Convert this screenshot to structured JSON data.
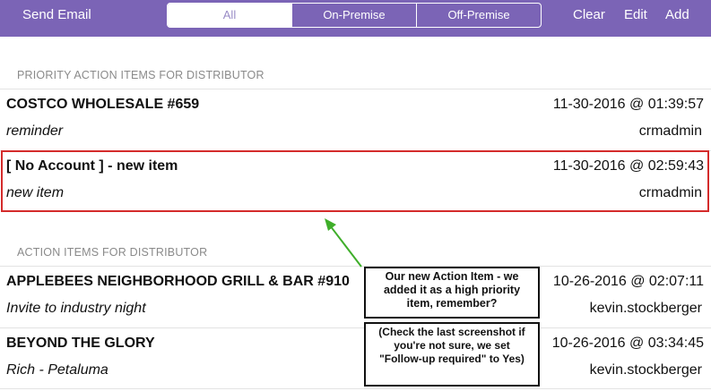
{
  "toolbar": {
    "send_email": "Send Email",
    "segments": [
      "All",
      "On-Premise",
      "Off-Premise"
    ],
    "selected_segment": "All",
    "clear": "Clear",
    "edit": "Edit",
    "add": "Add"
  },
  "priority_section": {
    "header": "PRIORITY ACTION ITEMS FOR DISTRIBUTOR",
    "items": [
      {
        "title": "COSTCO WHOLESALE #659",
        "date": "11-30-2016 @ 01:39:57",
        "note": "reminder",
        "user": "crmadmin"
      },
      {
        "title": "[ No Account ] - new item",
        "date": "11-30-2016 @ 02:59:43",
        "note": "new item",
        "user": "crmadmin"
      }
    ]
  },
  "action_section": {
    "header": "ACTION ITEMS FOR DISTRIBUTOR",
    "items": [
      {
        "title": "APPLEBEES NEIGHBORHOOD GRILL & BAR #910",
        "date": "10-26-2016 @ 02:07:11",
        "note": "Invite to industry night",
        "user": "kevin.stockberger"
      },
      {
        "title": "BEYOND THE GLORY",
        "date": "10-26-2016 @ 03:34:45",
        "note": "Rich - Petaluma",
        "user": "kevin.stockberger"
      }
    ]
  },
  "annotations": {
    "callout_1": "Our new Action Item - we added it as a high priority item, remember?",
    "callout_2": "(Check the last screenshot if you're not sure, we set \"Follow-up required\" to Yes)",
    "highlight_color": "#d42b2b",
    "arrow_color": "#3fae2a"
  },
  "colors": {
    "toolbar_bg": "#7b64b6",
    "selected_segment_text": "#9a8cc6"
  }
}
